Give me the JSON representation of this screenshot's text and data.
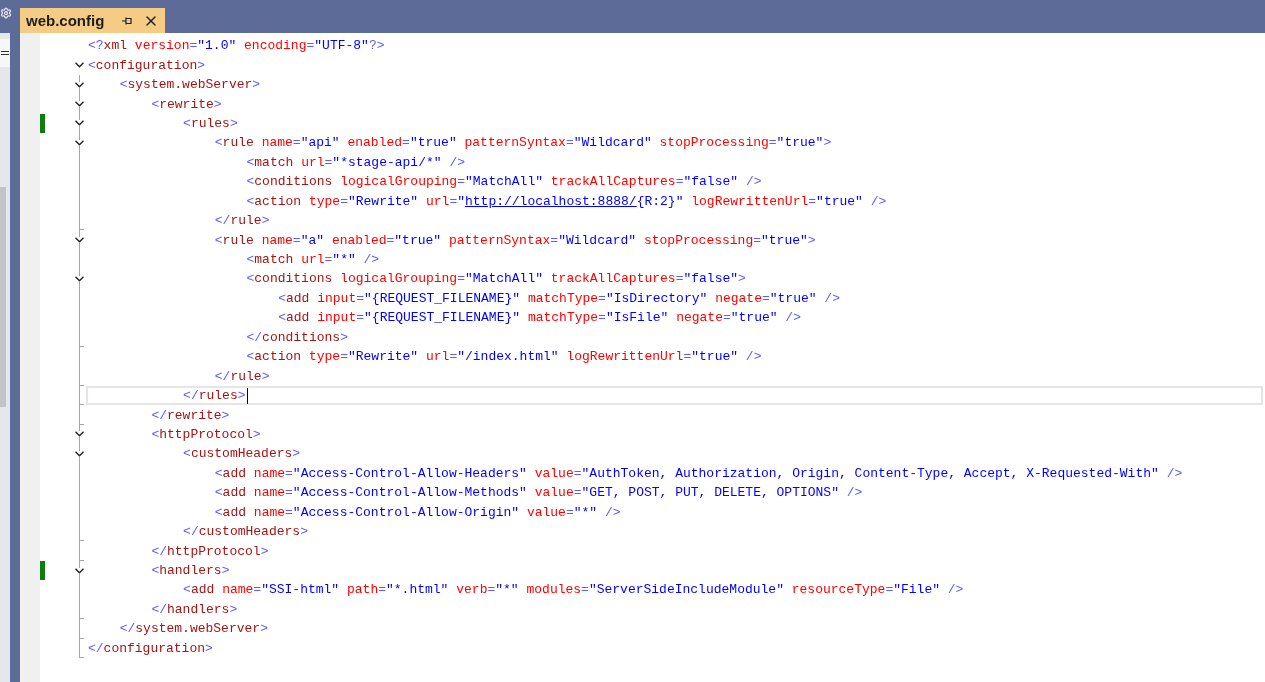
{
  "tab": {
    "title": "web.config",
    "selected": true
  },
  "document": [
    {
      "open": {
        "text": "<?xml version=\"1.0\" encoding=\"UTF-8\"?>",
        "changed": false,
        "current": false
      }
    },
    {
      "open": {
        "text": "<configuration>",
        "changed": false,
        "current": false
      },
      "children": [
        {
          "open": {
            "text": "<system.webServer>",
            "changed": false,
            "current": false
          },
          "children": [
            {
              "open": {
                "text": "<rewrite>",
                "changed": false,
                "current": false
              },
              "children": [
                {
                  "open": {
                    "text": "<rules>",
                    "changed": true,
                    "current": false
                  },
                  "children": [
                    {
                      "open": {
                        "text": "<rule name=\"api\" enabled=\"true\" patternSyntax=\"Wildcard\" stopProcessing=\"true\">",
                        "changed": false,
                        "current": false
                      },
                      "children": [
                        {
                          "open": {
                            "text": "<match url=\"*stage-api/*\" />",
                            "changed": false,
                            "current": false
                          }
                        },
                        {
                          "open": {
                            "text": "<conditions logicalGrouping=\"MatchAll\" trackAllCaptures=\"false\" />",
                            "changed": false,
                            "current": false
                          }
                        },
                        {
                          "open": {
                            "parts": [
                              {
                                "kind": "code",
                                "text": "<action type=\"Rewrite\" url=\""
                              },
                              {
                                "kind": "link",
                                "text": "http://localhost:8888/"
                              },
                              {
                                "kind": "code",
                                "text": "{R:2}\" logRewrittenUrl=\"true\" />"
                              }
                            ],
                            "changed": false,
                            "current": false
                          }
                        }
                      ],
                      "close": {
                        "text": "</rule>",
                        "changed": false,
                        "current": false
                      }
                    },
                    {
                      "open": {
                        "text": "<rule name=\"a\" enabled=\"true\" patternSyntax=\"Wildcard\" stopProcessing=\"true\">",
                        "changed": false,
                        "current": false
                      },
                      "children": [
                        {
                          "open": {
                            "text": "<match url=\"*\" />",
                            "changed": false,
                            "current": false
                          }
                        },
                        {
                          "open": {
                            "text": "<conditions logicalGrouping=\"MatchAll\" trackAllCaptures=\"false\">",
                            "changed": false,
                            "current": false
                          },
                          "children": [
                            {
                              "open": {
                                "text": "<add input=\"{REQUEST_FILENAME}\" matchType=\"IsDirectory\" negate=\"true\" />",
                                "changed": false,
                                "current": false
                              }
                            },
                            {
                              "open": {
                                "text": "<add input=\"{REQUEST_FILENAME}\" matchType=\"IsFile\" negate=\"true\" />",
                                "changed": false,
                                "current": false
                              }
                            }
                          ],
                          "close": {
                            "text": "</conditions>",
                            "changed": false,
                            "current": false
                          }
                        },
                        {
                          "open": {
                            "text": "<action type=\"Rewrite\" url=\"/index.html\" logRewrittenUrl=\"true\" />",
                            "changed": false,
                            "current": false
                          }
                        }
                      ],
                      "close": {
                        "text": "</rule>",
                        "changed": false,
                        "current": false
                      }
                    }
                  ],
                  "close": {
                    "text": "</rules>",
                    "changed": false,
                    "current": true
                  }
                }
              ],
              "close": {
                "text": "</rewrite>",
                "changed": false,
                "current": false
              }
            },
            {
              "open": {
                "text": "<httpProtocol>",
                "changed": false,
                "current": false
              },
              "children": [
                {
                  "open": {
                    "text": "<customHeaders>",
                    "changed": false,
                    "current": false
                  },
                  "children": [
                    {
                      "open": {
                        "text": "<add name=\"Access-Control-Allow-Headers\" value=\"AuthToken, Authorization, Origin, Content-Type, Accept, X-Requested-With\" />",
                        "changed": false,
                        "current": false
                      }
                    },
                    {
                      "open": {
                        "text": "<add name=\"Access-Control-Allow-Methods\" value=\"GET, POST, PUT, DELETE, OPTIONS\" />",
                        "changed": false,
                        "current": false
                      }
                    },
                    {
                      "open": {
                        "text": "<add name=\"Access-Control-Allow-Origin\" value=\"*\" />",
                        "changed": false,
                        "current": false
                      }
                    }
                  ],
                  "close": {
                    "text": "</customHeaders>",
                    "changed": false,
                    "current": false
                  }
                }
              ],
              "close": {
                "text": "</httpProtocol>",
                "changed": false,
                "current": false
              }
            },
            {
              "open": {
                "text": "<handlers>",
                "changed": true,
                "current": false
              },
              "children": [
                {
                  "open": {
                    "text": "<add name=\"SSI-html\" path=\"*.html\" verb=\"*\" modules=\"ServerSideIncludeModule\" resourceType=\"File\" />",
                    "changed": false,
                    "current": false
                  }
                }
              ],
              "close": {
                "text": "</handlers>",
                "changed": false,
                "current": false
              }
            }
          ],
          "close": {
            "text": "</system.webServer>",
            "changed": false,
            "current": false
          }
        }
      ],
      "close": {
        "text": "</configuration>",
        "changed": false,
        "current": false
      }
    }
  ]
}
